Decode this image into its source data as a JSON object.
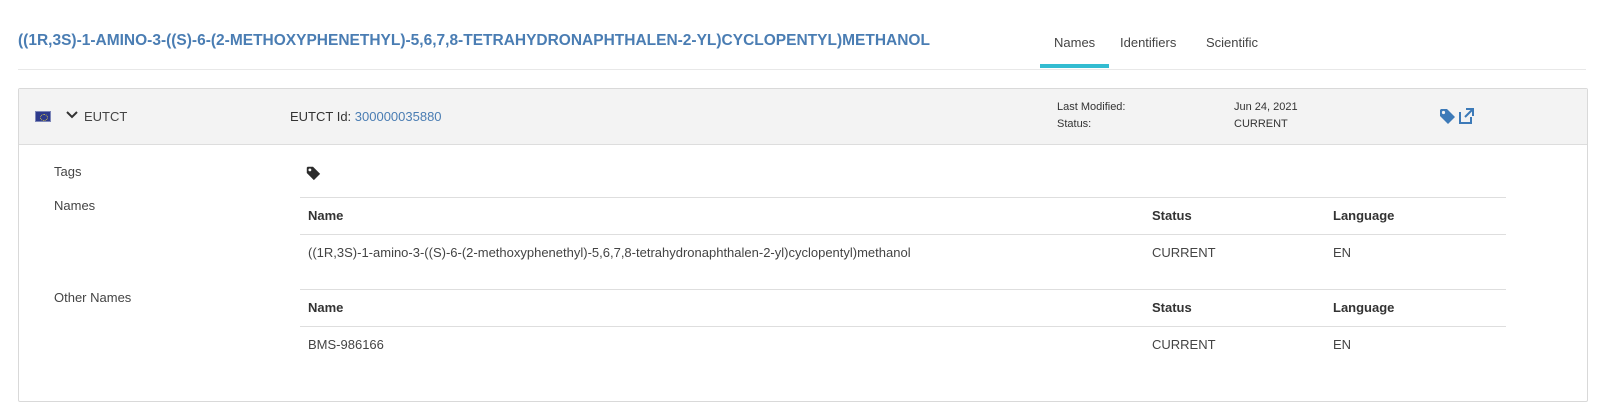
{
  "page": {
    "title": "((1R,3S)-1-AMINO-3-((S)-6-(2-METHOXYPHENETHYL)-5,6,7,8-TETRAHYDRONAPHTHALEN-2-YL)CYCLOPENTYL)METHANOL"
  },
  "tabs": [
    {
      "label": "Names",
      "active": true
    },
    {
      "label": "Identifiers",
      "active": false
    },
    {
      "label": "Scientific",
      "active": false
    }
  ],
  "card": {
    "source": "EUTCT",
    "id_label": "EUTCT Id: ",
    "id_value": "300000035880",
    "last_modified_label": "Last Modified:",
    "last_modified_value": "Jun 24, 2021",
    "status_label": "Status:",
    "status_value": "CURRENT",
    "icons": [
      "flag-eu-icon",
      "chevron-down-icon",
      "tag-icon",
      "external-link-icon"
    ],
    "accent_color": "#4a7db3"
  },
  "sections": {
    "tags_label": "Tags",
    "names_label": "Names",
    "other_names_label": "Other Names"
  },
  "names_table": {
    "headers": [
      "Name",
      "Status",
      "Language"
    ],
    "rows": [
      [
        "((1R,3S)-1-amino-3-((S)-6-(2-methoxyphenethyl)-5,6,7,8-tetrahydronaphthalen-2-yl)cyclopentyl)methanol",
        "CURRENT",
        "EN"
      ]
    ]
  },
  "other_names_table": {
    "headers": [
      "Name",
      "Status",
      "Language"
    ],
    "rows": [
      [
        "BMS-986166",
        "CURRENT",
        "EN"
      ]
    ]
  }
}
